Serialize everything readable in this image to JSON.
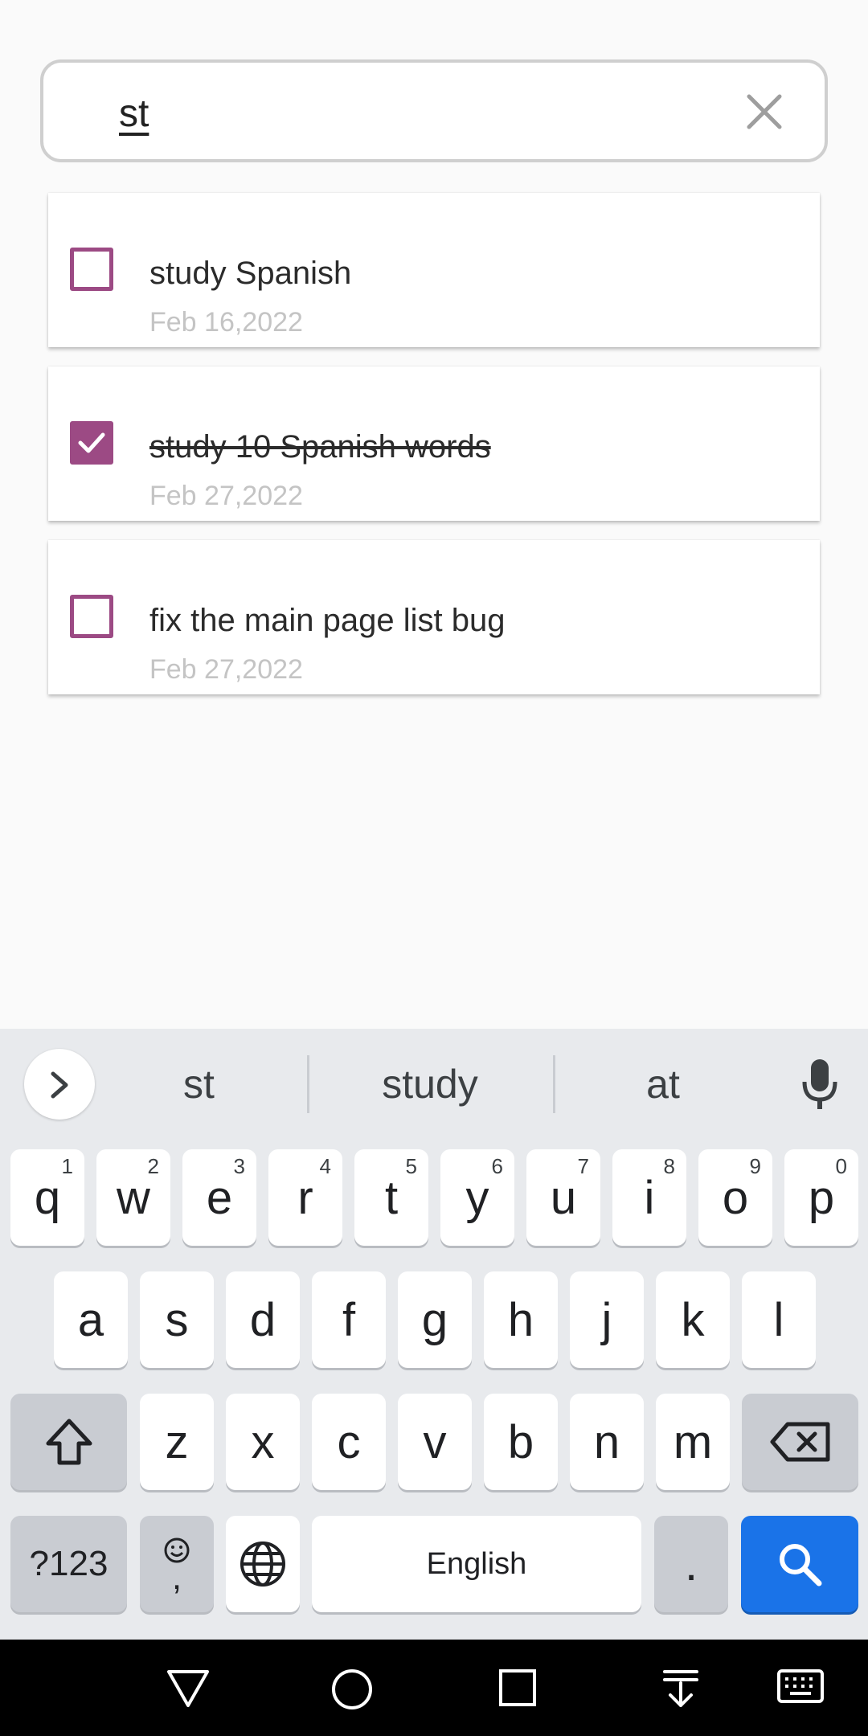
{
  "search": {
    "query": "st"
  },
  "todos": [
    {
      "title": "study Spanish",
      "date": "Feb 16,2022",
      "done": false
    },
    {
      "title": "study 10 Spanish words",
      "date": "Feb 27,2022",
      "done": true
    },
    {
      "title": "fix the main page list bug",
      "date": "Feb 27,2022",
      "done": false
    }
  ],
  "keyboard": {
    "suggestions": [
      "st",
      "study",
      "at"
    ],
    "row1": [
      {
        "k": "q",
        "h": "1"
      },
      {
        "k": "w",
        "h": "2"
      },
      {
        "k": "e",
        "h": "3"
      },
      {
        "k": "r",
        "h": "4"
      },
      {
        "k": "t",
        "h": "5"
      },
      {
        "k": "y",
        "h": "6"
      },
      {
        "k": "u",
        "h": "7"
      },
      {
        "k": "i",
        "h": "8"
      },
      {
        "k": "o",
        "h": "9"
      },
      {
        "k": "p",
        "h": "0"
      }
    ],
    "row2": [
      "a",
      "s",
      "d",
      "f",
      "g",
      "h",
      "j",
      "k",
      "l"
    ],
    "row3": [
      "z",
      "x",
      "c",
      "v",
      "b",
      "n",
      "m"
    ],
    "symbols_label": "?123",
    "comma_label": ",",
    "space_label": "English",
    "period_label": "."
  },
  "colors": {
    "accent": "#9c4a84",
    "search_key": "#1a73e8"
  }
}
